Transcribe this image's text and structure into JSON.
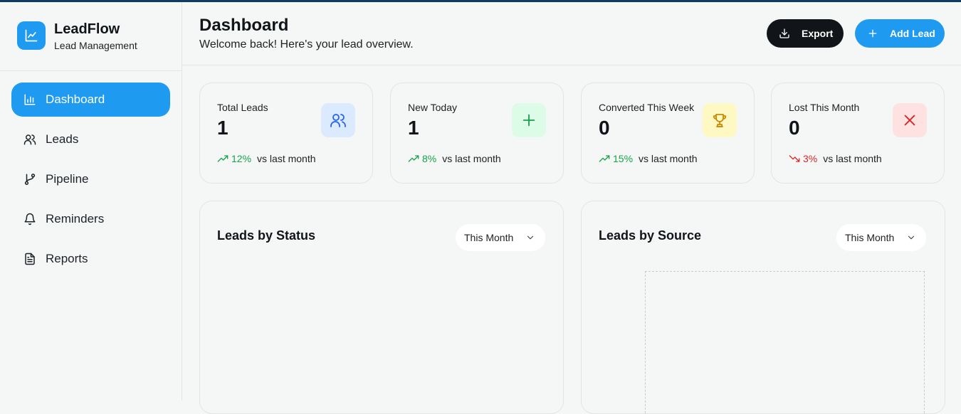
{
  "brand": {
    "name": "LeadFlow",
    "subtitle": "Lead Management"
  },
  "sidebar": {
    "items": [
      {
        "label": "Dashboard",
        "icon": "bar-chart-icon",
        "active": true
      },
      {
        "label": "Leads",
        "icon": "users-icon",
        "active": false
      },
      {
        "label": "Pipeline",
        "icon": "git-branch-icon",
        "active": false
      },
      {
        "label": "Reminders",
        "icon": "bell-icon",
        "active": false
      },
      {
        "label": "Reports",
        "icon": "file-text-icon",
        "active": false
      }
    ]
  },
  "header": {
    "title": "Dashboard",
    "subtitle": "Welcome back! Here's your lead overview.",
    "export_label": "Export",
    "add_label": "Add Lead"
  },
  "stats": [
    {
      "label": "Total Leads",
      "value": "1",
      "trend": "12%",
      "direction": "up",
      "trend_text": "vs last month",
      "icon": "users-icon",
      "icon_bg": "#dbeafe",
      "icon_color": "#2563eb"
    },
    {
      "label": "New Today",
      "value": "1",
      "trend": "8%",
      "direction": "up",
      "trend_text": "vs last month",
      "icon": "plus-icon",
      "icon_bg": "#dcfce7",
      "icon_color": "#16a34a"
    },
    {
      "label": "Converted This Week",
      "value": "0",
      "trend": "15%",
      "direction": "up",
      "trend_text": "vs last month",
      "icon": "trophy-icon",
      "icon_bg": "#fef9c3",
      "icon_color": "#ca8a04"
    },
    {
      "label": "Lost This Month",
      "value": "0",
      "trend": "3%",
      "direction": "down",
      "trend_text": "vs last month",
      "icon": "x-icon",
      "icon_bg": "#fee2e2",
      "icon_color": "#dc2626"
    }
  ],
  "panels": [
    {
      "title": "Leads by Status",
      "range": "This Month"
    },
    {
      "title": "Leads by Source",
      "range": "This Month"
    }
  ],
  "colors": {
    "accent": "#1e9bf0",
    "dark": "#111418",
    "up": "#17a34a",
    "down": "#dc2626"
  }
}
